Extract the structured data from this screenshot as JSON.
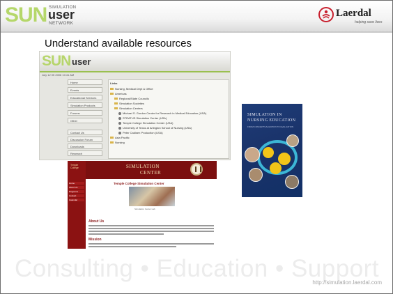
{
  "header": {
    "logo": {
      "mark": "SUN",
      "line_top": "SIMULATION",
      "main": "user",
      "line_bottom": "NETWORK"
    },
    "brand": {
      "name": "Laerdal",
      "tagline": "helping save lives",
      "icon": "laerdal-figure-icon"
    }
  },
  "slide": {
    "title": "Understand available resources",
    "footer_tagline": "Consulting  •  Education  •  Support",
    "url": "http://simulation.laerdal.com"
  },
  "screenshot_sun_site": {
    "logo_mark": "SUN",
    "logo_main": "user",
    "date": "July 12 05 2006 10:41 AM",
    "nav_buttons": [
      "Home",
      "Events",
      "Educational Services",
      "Simulation Products",
      "Forums",
      "Other",
      "Contact Us",
      "Discussion Forum",
      "Downloads",
      "Research"
    ],
    "tree_header": "Links",
    "tree": [
      {
        "kind": "folder",
        "label": "Nursing, Medical Dept & Office"
      },
      {
        "kind": "folder",
        "label": "Americas"
      },
      {
        "kind": "folder",
        "label": "Regional/State Councils"
      },
      {
        "kind": "folder",
        "label": "Simulation Societies"
      },
      {
        "kind": "folder",
        "label": "Simulation Centers"
      },
      {
        "kind": "item",
        "label": "Michael S. Gordon Center for Research in Medical Education (USA)"
      },
      {
        "kind": "item",
        "label": "STRATUS Simulation Center (USA)"
      },
      {
        "kind": "item",
        "label": "Temple College Simulation Center (USA)"
      },
      {
        "kind": "item",
        "label": "University of Texas at Arlington School of Nursing (USA)"
      },
      {
        "kind": "item",
        "label": "Peter Cadlsen Production (USA)"
      },
      {
        "kind": "folder",
        "label": "Asia Pacific"
      },
      {
        "kind": "folder",
        "label": "Nursing"
      }
    ]
  },
  "screenshot_center_site": {
    "side_title": "Temple College",
    "side_nav": [
      "Home",
      "About Us",
      "Programs",
      "Contact",
      "Calendar"
    ],
    "title_line1": "SIMULATION",
    "title_line2": "CENTER",
    "page_heading": "Temple College Simulation Center",
    "photo_caption": "Simulation Center Lab",
    "section1": "About Us",
    "section2": "Mission"
  },
  "book": {
    "title_line1": "SIMULATION IN",
    "title_line2": "NURSING EDUCATION",
    "subtitle": "FROM CONCEPTUALIZATION TO EVALUATION",
    "cover_color": "#1b3670",
    "ring_color": "#3cb6d6",
    "disc_color": "#f2c418"
  }
}
